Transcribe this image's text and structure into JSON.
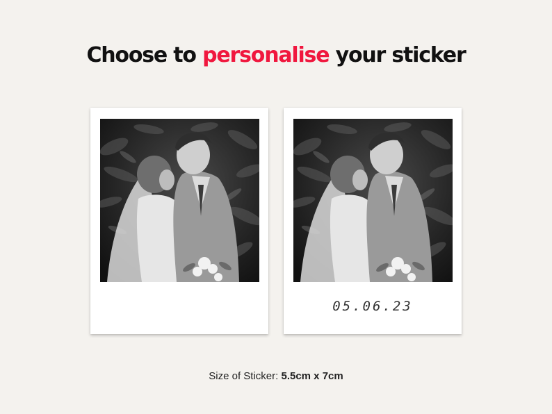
{
  "headline": {
    "prefix": "Choose to",
    "accent": "personalise",
    "suffix": "your sticker",
    "accent_color": "#f0173e"
  },
  "stickers": [
    {
      "caption": ""
    },
    {
      "caption": "05.06.23"
    }
  ],
  "size_info": {
    "label": "Size of Sticker:",
    "value": "5.5cm x 7cm"
  }
}
